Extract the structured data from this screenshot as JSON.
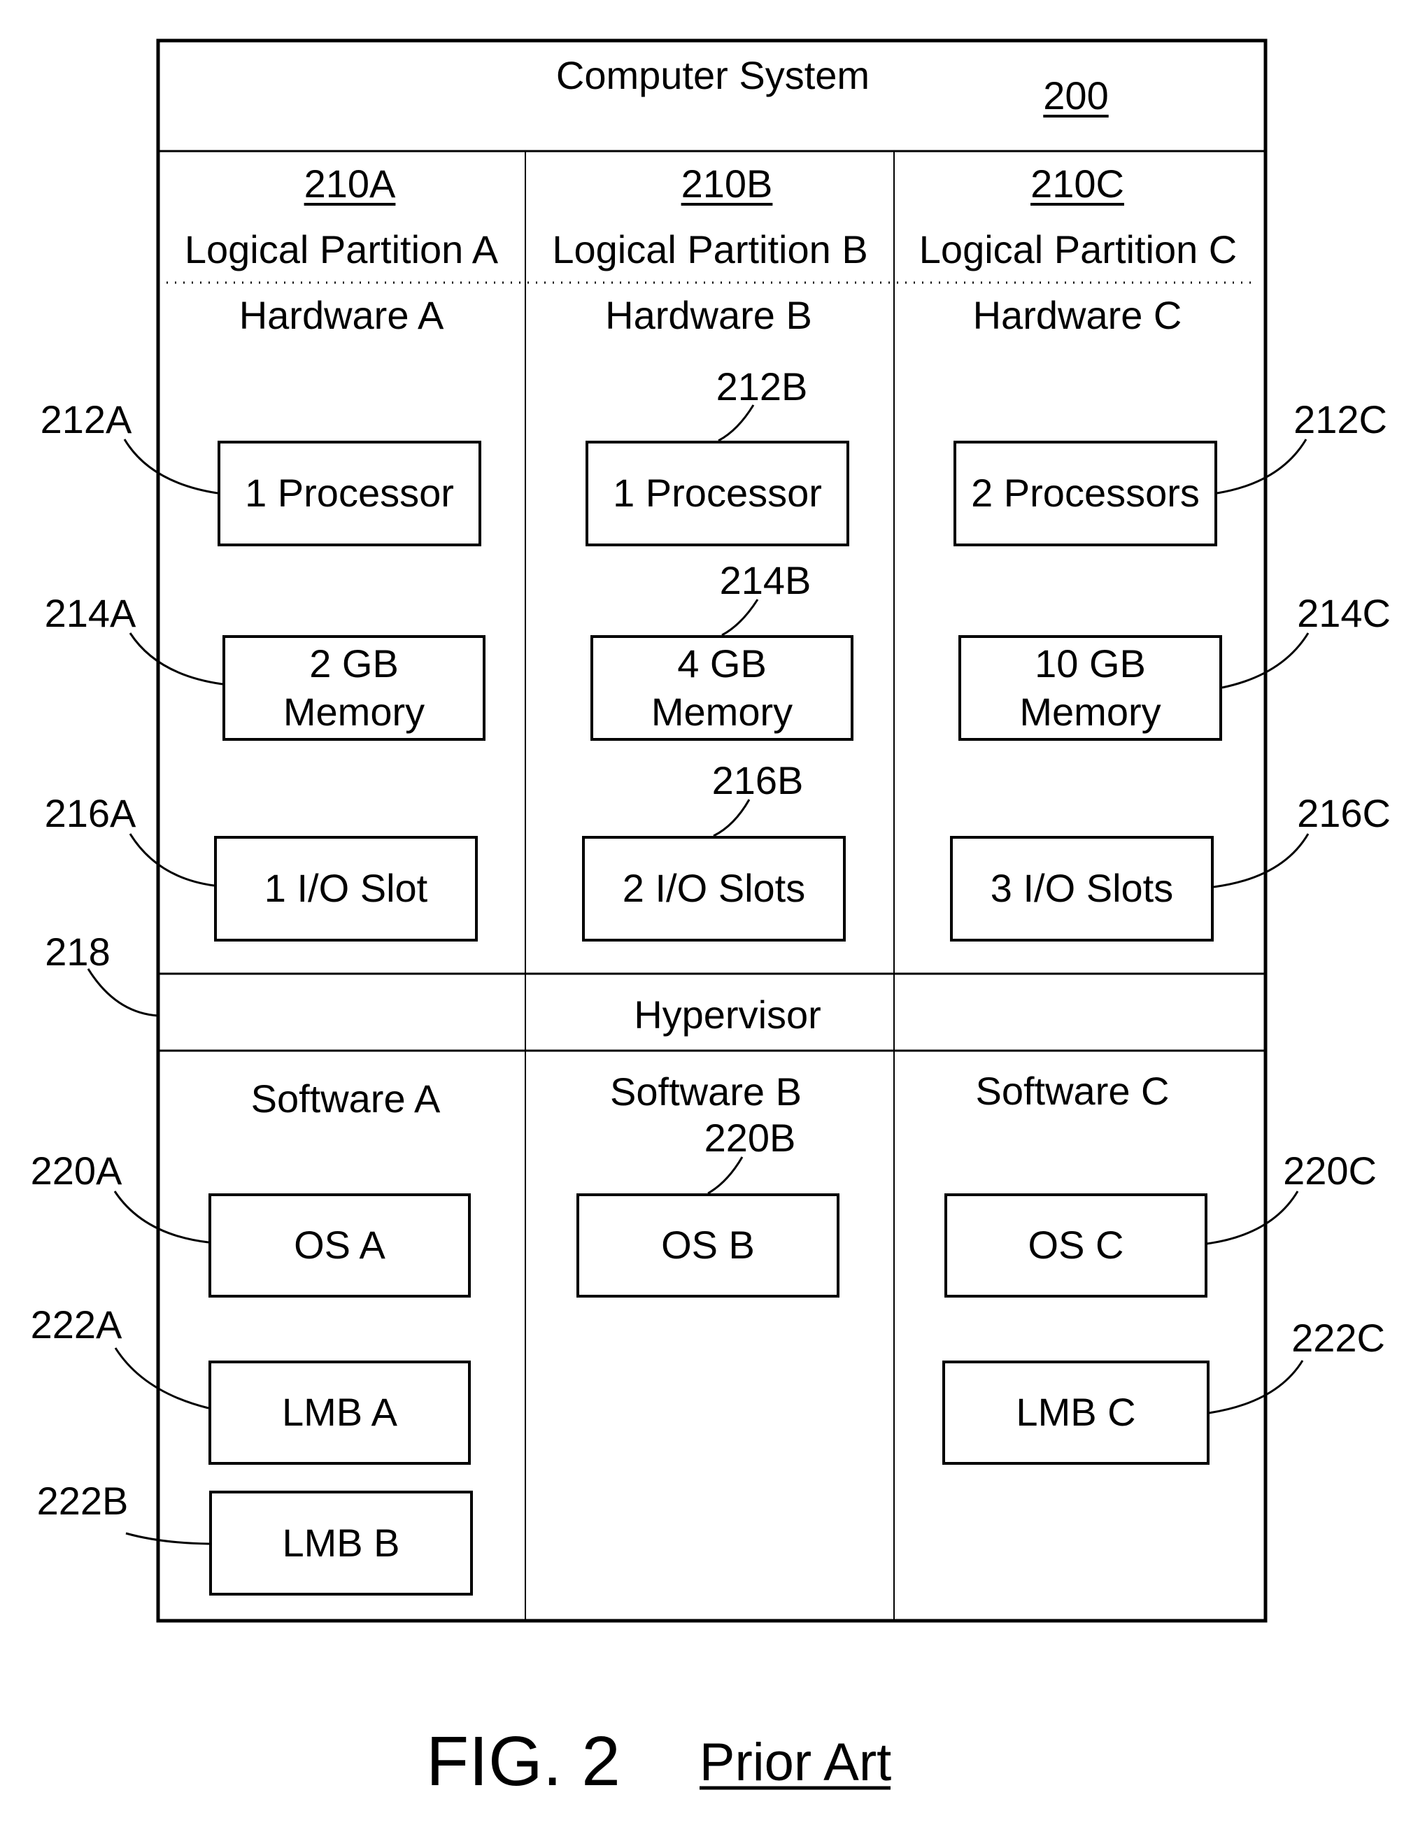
{
  "system": {
    "title": "Computer System",
    "ref": "200"
  },
  "partitions": [
    {
      "ref": "210A",
      "name": "Logical Partition A",
      "hardware_title": "Hardware A",
      "software_title": "Software A"
    },
    {
      "ref": "210B",
      "name": "Logical Partition B",
      "hardware_title": "Hardware B",
      "software_title": "Software B"
    },
    {
      "ref": "210C",
      "name": "Logical Partition C",
      "hardware_title": "Hardware C",
      "software_title": "Software C"
    }
  ],
  "hardware": {
    "a": {
      "processor": "1 Processor",
      "memory_line1": "2 GB",
      "memory_line2": "Memory",
      "io": "1 I/O Slot"
    },
    "b": {
      "processor": "1 Processor",
      "memory_line1": "4 GB",
      "memory_line2": "Memory",
      "io": "2 I/O Slots"
    },
    "c": {
      "processor": "2 Processors",
      "memory_line1": "10 GB",
      "memory_line2": "Memory",
      "io": "3 I/O Slots"
    }
  },
  "hypervisor": {
    "label": "Hypervisor"
  },
  "software": {
    "a": {
      "os": "OS A",
      "lmb1": "LMB A",
      "lmb2": "LMB B"
    },
    "b": {
      "os": "OS B"
    },
    "c": {
      "os": "OS C",
      "lmb1": "LMB C"
    }
  },
  "refs": {
    "r212A": "212A",
    "r214A": "214A",
    "r216A": "216A",
    "r218": "218",
    "r220A": "220A",
    "r222A": "222A",
    "r222B": "222B",
    "r212B": "212B",
    "r214B": "214B",
    "r216B": "216B",
    "r220B": "220B",
    "r212C": "212C",
    "r214C": "214C",
    "r216C": "216C",
    "r220C": "220C",
    "r222C": "222C"
  },
  "caption": {
    "figure": "FIG. 2",
    "note": "Prior Art"
  }
}
